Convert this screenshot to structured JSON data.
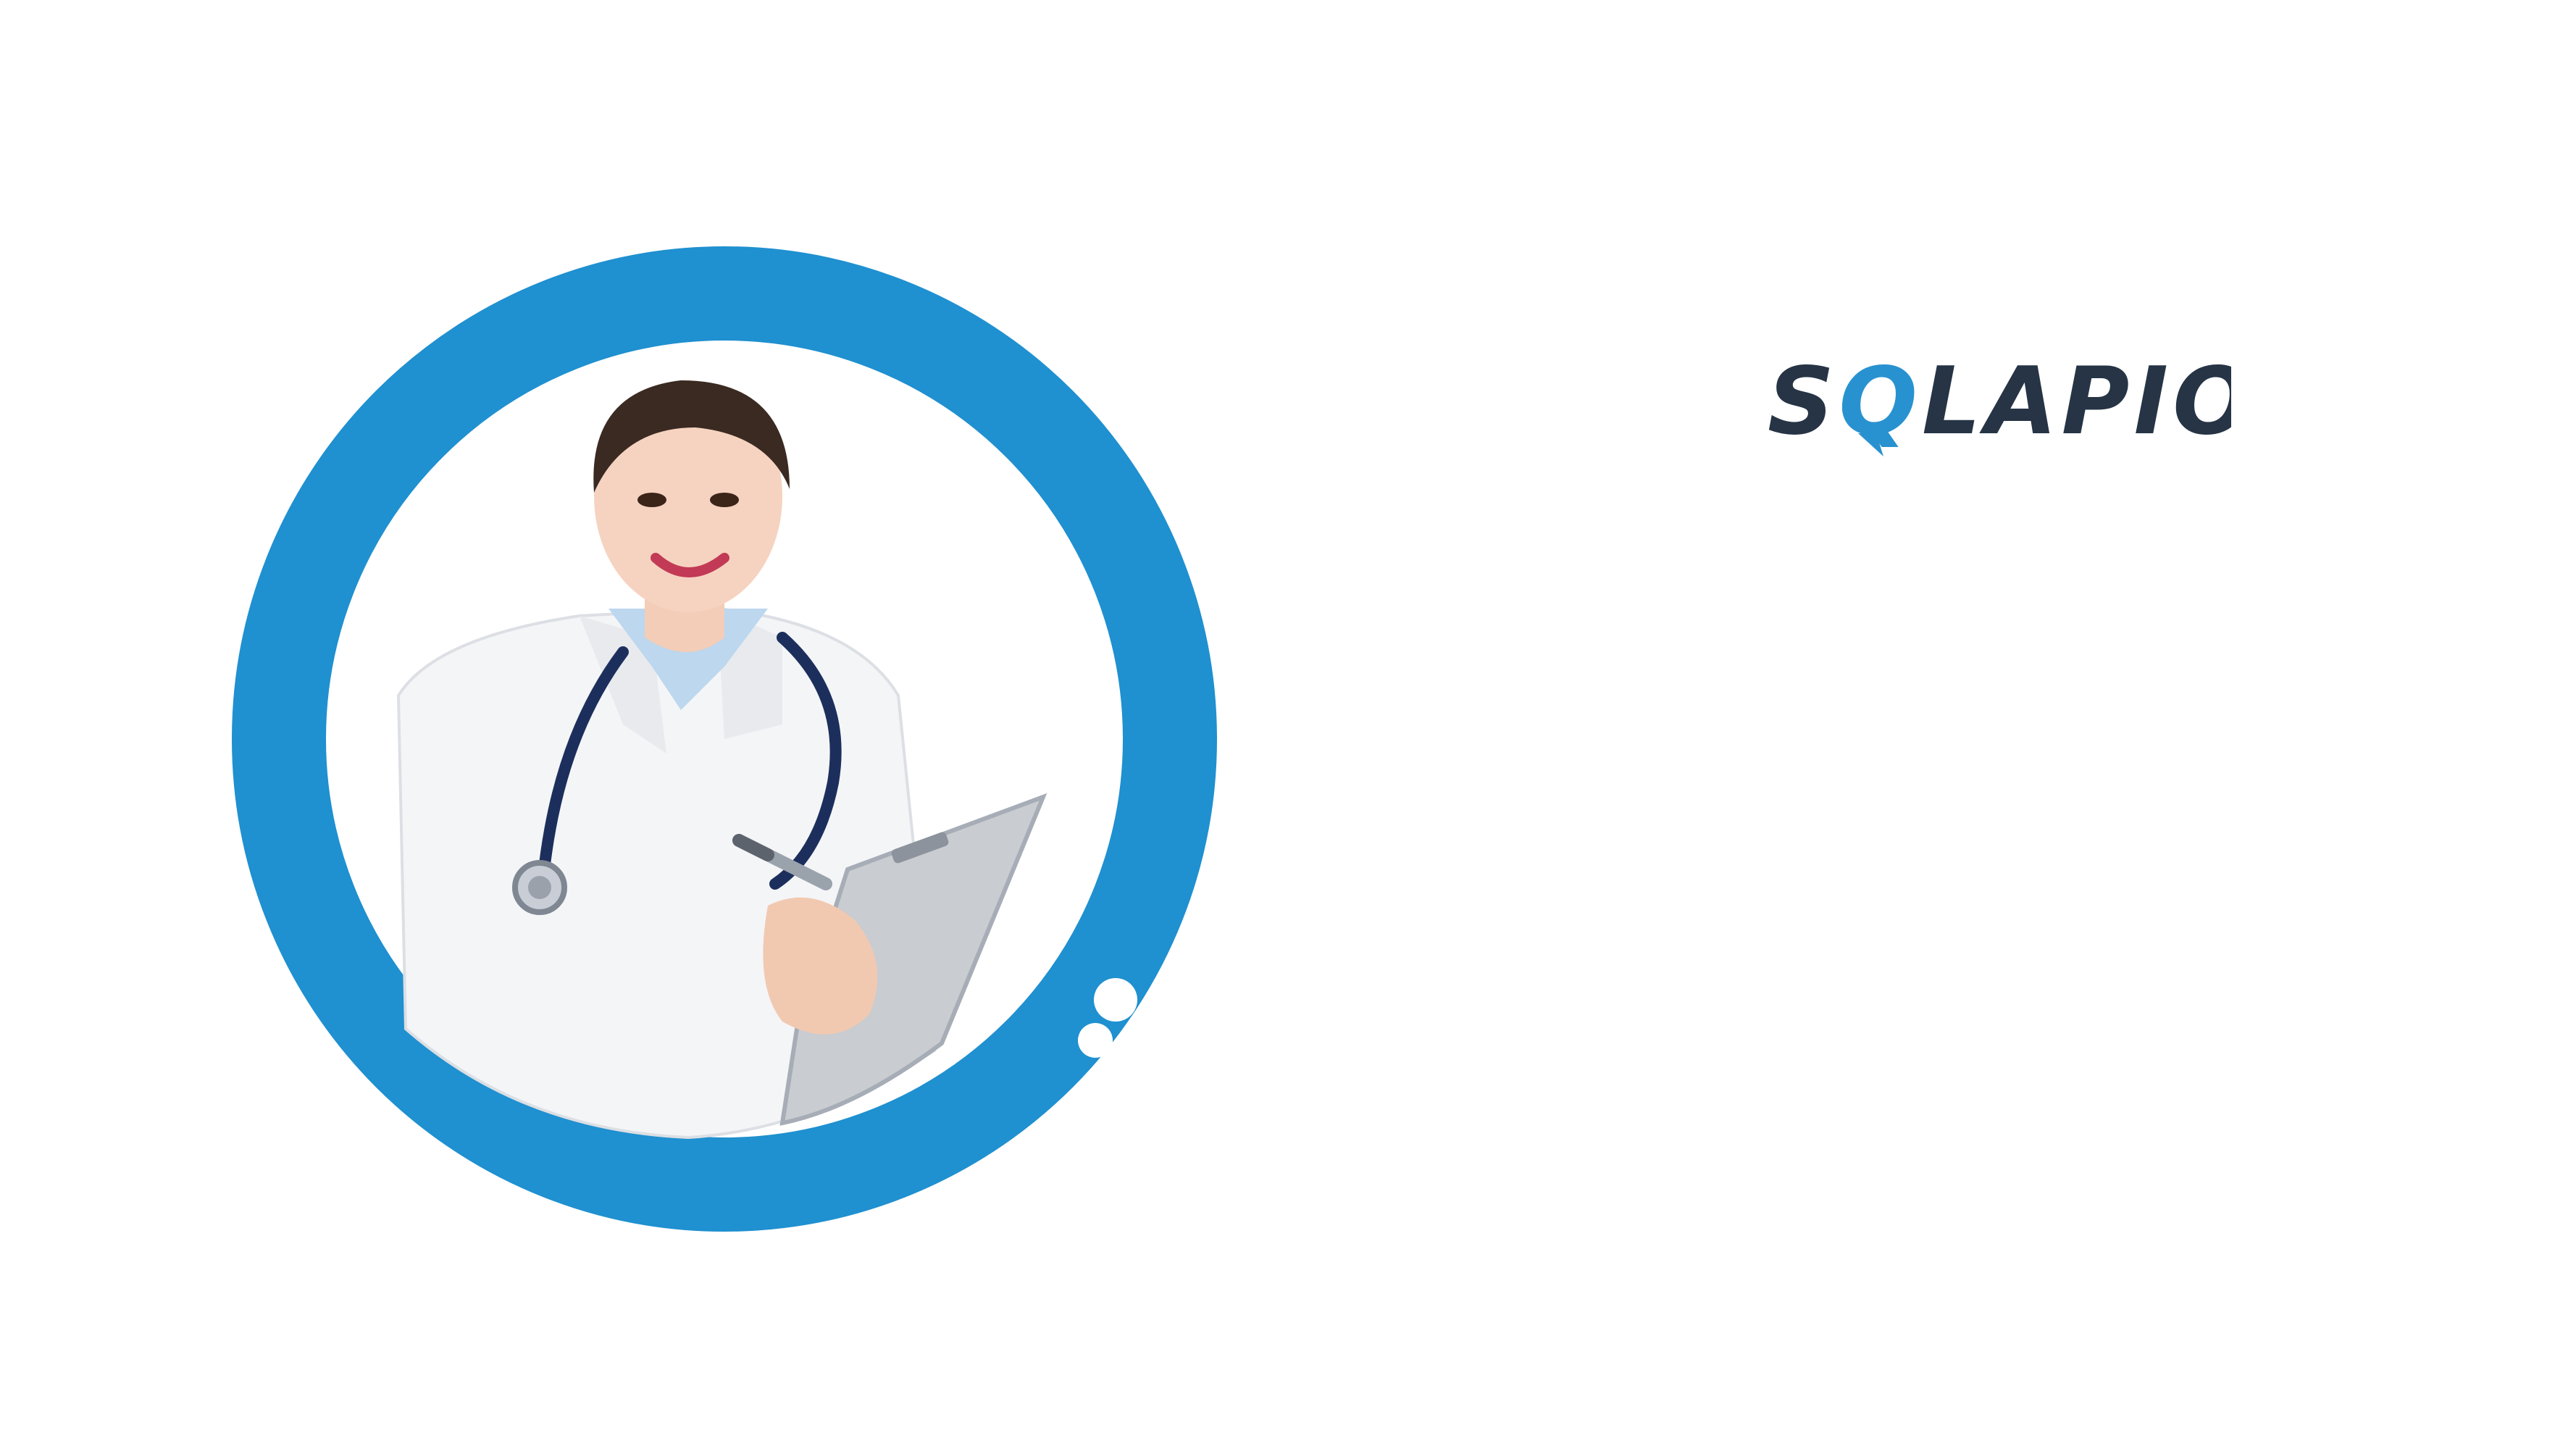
{
  "brand": {
    "logo": {
      "part1": "S",
      "part2": "Q",
      "part3": "LAPIO"
    },
    "colors": {
      "primary_dark": "#263445",
      "accent_blue": "#2892d0",
      "ring_blue": "#1f90d0"
    }
  },
  "hero": {
    "subject": "doctor-with-clipboard",
    "icons": [
      "stethoscope-icon",
      "clipboard-icon",
      "pen-icon"
    ]
  }
}
